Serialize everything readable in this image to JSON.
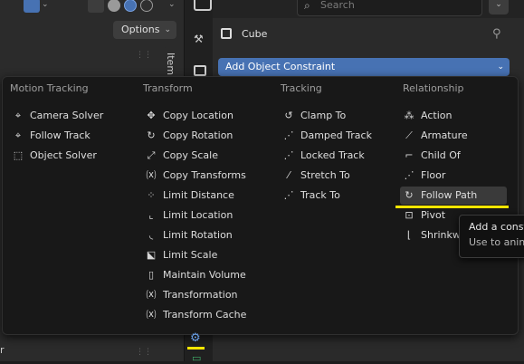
{
  "viewport_header": {
    "shading_modes": [
      "wireframe",
      "solid",
      "material-preview",
      "rendered"
    ]
  },
  "options_button": {
    "label": "Options",
    "chevron": "⌄"
  },
  "sidebar": {
    "tab_label": "Item"
  },
  "bottom_left_text": "r",
  "properties": {
    "search_placeholder": "Search",
    "object_name": "Cube",
    "add_constraint_label": "Add Object Constraint",
    "chevron": "⌄"
  },
  "menu": {
    "columns": [
      {
        "title": "Motion Tracking",
        "items": [
          {
            "label": "Camera Solver",
            "icon": "camera-solver-icon"
          },
          {
            "label": "Follow Track",
            "icon": "follow-track-icon"
          },
          {
            "label": "Object Solver",
            "icon": "object-solver-icon"
          }
        ]
      },
      {
        "title": "Transform",
        "items": [
          {
            "label": "Copy Location",
            "icon": "copy-location-icon"
          },
          {
            "label": "Copy Rotation",
            "icon": "copy-rotation-icon"
          },
          {
            "label": "Copy Scale",
            "icon": "copy-scale-icon"
          },
          {
            "label": "Copy Transforms",
            "icon": "copy-transforms-icon"
          },
          {
            "label": "Limit Distance",
            "icon": "limit-distance-icon"
          },
          {
            "label": "Limit Location",
            "icon": "limit-location-icon"
          },
          {
            "label": "Limit Rotation",
            "icon": "limit-rotation-icon"
          },
          {
            "label": "Limit Scale",
            "icon": "limit-scale-icon"
          },
          {
            "label": "Maintain Volume",
            "icon": "maintain-volume-icon"
          },
          {
            "label": "Transformation",
            "icon": "transformation-icon"
          },
          {
            "label": "Transform Cache",
            "icon": "transform-cache-icon"
          }
        ]
      },
      {
        "title": "Tracking",
        "items": [
          {
            "label": "Clamp To",
            "icon": "clamp-to-icon"
          },
          {
            "label": "Damped Track",
            "icon": "damped-track-icon"
          },
          {
            "label": "Locked Track",
            "icon": "locked-track-icon"
          },
          {
            "label": "Stretch To",
            "icon": "stretch-to-icon"
          },
          {
            "label": "Track To",
            "icon": "track-to-icon"
          }
        ]
      },
      {
        "title": "Relationship",
        "items": [
          {
            "label": "Action",
            "icon": "action-icon"
          },
          {
            "label": "Armature",
            "icon": "armature-icon"
          },
          {
            "label": "Child Of",
            "icon": "child-of-icon"
          },
          {
            "label": "Floor",
            "icon": "floor-icon"
          },
          {
            "label": "Follow Path",
            "icon": "follow-path-icon",
            "highlighted": true
          },
          {
            "label": "Pivot",
            "icon": "pivot-icon"
          },
          {
            "label": "Shrinkwrap",
            "icon": "shrinkwrap-icon"
          }
        ]
      }
    ]
  },
  "tooltip": {
    "line1": "Add a constraint",
    "line2": "Use to animate"
  },
  "annotation_color": "#ffe600",
  "accent_color": "#4772b3"
}
